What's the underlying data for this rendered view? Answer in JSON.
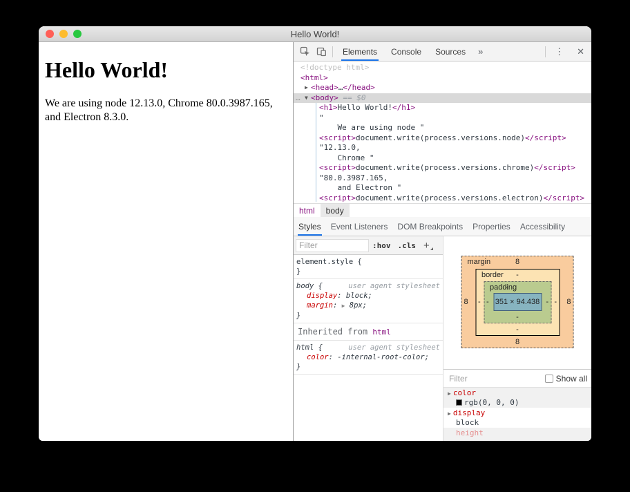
{
  "window": {
    "title": "Hello World!"
  },
  "colors": {
    "accent_blue": "#1a73e8",
    "tag_purple": "#881280",
    "property_red": "#c80000",
    "traffic_red": "#ff5f57",
    "traffic_yellow": "#febc2e",
    "traffic_green": "#28c840",
    "selected_row": "#d9d9d9",
    "box_margin": "#f9cc9e",
    "box_border": "#fce3b3",
    "box_padding": "#bacb8f",
    "box_content": "#87b4c0"
  },
  "icons": {
    "more": "…",
    "collapse": "▼",
    "expand": "▶",
    "overflow": "»",
    "kebab": "⋮",
    "close": "✕"
  },
  "page": {
    "heading": "Hello World!",
    "body_text": "We are using node 12.13.0, Chrome 80.0.3987.165, and Electron 8.3.0."
  },
  "devtools": {
    "toolbar": {
      "tabs": [
        {
          "label": "Elements"
        },
        {
          "label": "Console"
        },
        {
          "label": "Sources"
        }
      ]
    },
    "elements_tree": {
      "lines": [
        {
          "g": "<!doctype html>"
        },
        {
          "t1": "<html>"
        },
        {
          "t1": "<head>",
          "mid": "…",
          "t2": "</head>"
        },
        {
          "t1": "<body>",
          "eq": " == $0"
        },
        {
          "t1": "<h1>",
          "mid": "Hello World!",
          "t2": "</h1>"
        },
        {
          "mid": "\""
        },
        {
          "mid": "    We are using node \""
        },
        {
          "t1": "<script>",
          "mid": "document.write(process.versions.node)",
          "t2": "</script>"
        },
        {
          "mid": "\"12.13.0,"
        },
        {
          "mid": "    Chrome \""
        },
        {
          "t1": "<script>",
          "mid": "document.write(process.versions.chrome)",
          "t2": "</script>"
        },
        {
          "mid": "\"80.0.3987.165,"
        },
        {
          "mid": "    and Electron \""
        },
        {
          "t1": "<script>",
          "mid": "document.write(process.versions.electron)",
          "t2": "</script>"
        }
      ]
    },
    "breadcrumbs": [
      {
        "label": "html"
      },
      {
        "label": "body"
      }
    ],
    "sidebar_tabs": [
      "Styles",
      "Event Listeners",
      "DOM Breakpoints",
      "Properties",
      "Accessibility"
    ],
    "styles": {
      "filter_placeholder": "Filter",
      "hov_label": ":hov",
      "cls_label": ".cls",
      "add_label": "+",
      "brace_open": "{",
      "brace_close": "}",
      "rules": [
        {
          "selector": "element.style",
          "note": ""
        },
        {
          "selector": "body",
          "note": "user agent stylesheet",
          "props": [
            {
              "name": "display",
              "value": "block;"
            },
            {
              "name": "margin",
              "value": "8px;"
            }
          ]
        }
      ],
      "inherited_label": "Inherited from",
      "inherited_link": "html",
      "inherited_rule": {
        "selector": "html",
        "note": "user agent stylesheet",
        "props": [
          {
            "name": "color",
            "value": "-internal-root-color;"
          }
        ]
      }
    },
    "box_model": {
      "margin_label": "margin",
      "border_label": "border",
      "padding_label": "padding",
      "margin": {
        "top": "8",
        "right": "8",
        "bottom": "8",
        "left": "8"
      },
      "border": {
        "top": "-",
        "right": "-",
        "bottom": "-",
        "left": "-"
      },
      "padding": {
        "top": "-",
        "right": "-",
        "bottom": "-",
        "left": "-"
      },
      "content": "351 × 94.438"
    },
    "computed": {
      "filter_placeholder": "Filter",
      "show_all_label": "Show all",
      "props": [
        {
          "name": "color",
          "value": "rgb(0, 0, 0)",
          "swatch": "#000000"
        },
        {
          "name": "display",
          "value": "block"
        },
        {
          "name": "height",
          "value": ""
        }
      ]
    }
  }
}
